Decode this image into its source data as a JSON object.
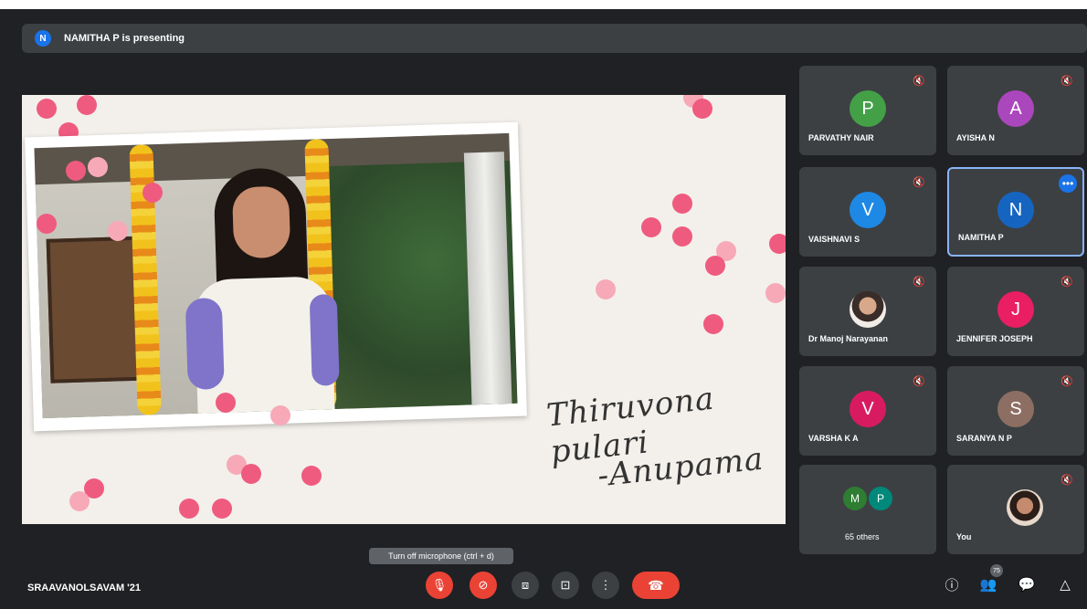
{
  "banner": {
    "avatar_letter": "N",
    "text": "NAMITHA P is presenting"
  },
  "slide": {
    "script_line1": "Thiruvona pulari",
    "script_line2": "-Anupama"
  },
  "participants": [
    {
      "name": "PARVATHY NAIR",
      "letter": "P",
      "color": "#43a047"
    },
    {
      "name": "AYISHA N",
      "letter": "A",
      "color": "#ab47bc"
    },
    {
      "name": "VAISHNAVI S",
      "letter": "V",
      "color": "#1e88e5"
    },
    {
      "name": "NAMITHA P",
      "letter": "N",
      "color": "#1565c0"
    },
    {
      "name": "Dr Manoj Narayanan",
      "letter": "",
      "color": "#ffffff"
    },
    {
      "name": "JENNIFER JOSEPH",
      "letter": "J",
      "color": "#e91e63"
    },
    {
      "name": "VARSHA K A",
      "letter": "V",
      "color": "#d81b60"
    },
    {
      "name": "SARANYA N P",
      "letter": "S",
      "color": "#8d6e63"
    },
    {
      "name": "65 others",
      "letter_a": "M",
      "letter_b": "P",
      "color_a": "#2e7d32",
      "color_b": "#00897b"
    },
    {
      "name": "You",
      "letter": "",
      "color": "#ffffff"
    }
  ],
  "toolbar": {
    "meeting_name": "SRAAVANOLSAVAM '21",
    "tooltip": "Turn off microphone (ctrl + d)",
    "participants_count": "75"
  }
}
